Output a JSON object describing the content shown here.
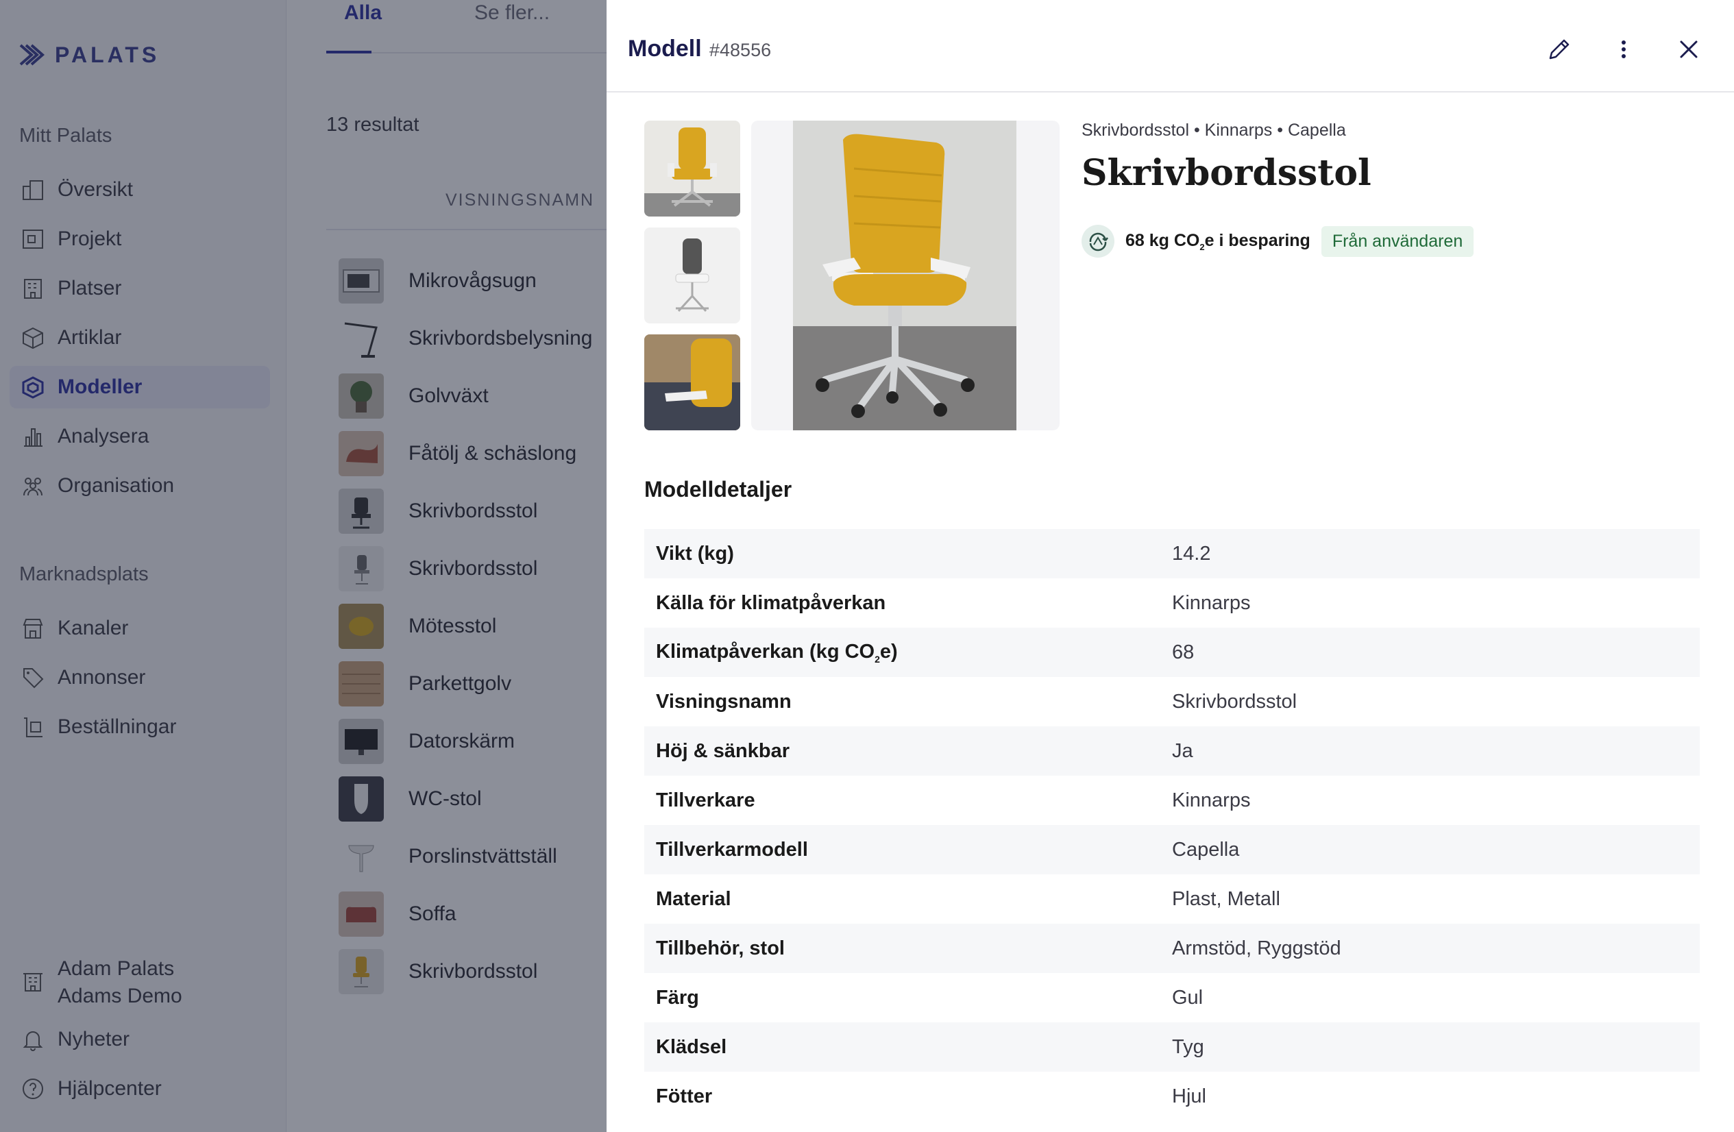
{
  "sidebar": {
    "brand": "PALATS",
    "section_mine": "Mitt Palats",
    "nav": [
      {
        "label": "Översikt",
        "icon": "overview-icon"
      },
      {
        "label": "Projekt",
        "icon": "project-icon"
      },
      {
        "label": "Platser",
        "icon": "building-icon"
      },
      {
        "label": "Artiklar",
        "icon": "box-icon"
      },
      {
        "label": "Modeller",
        "icon": "model-icon",
        "active": true
      },
      {
        "label": "Analysera",
        "icon": "bar-chart-icon"
      },
      {
        "label": "Organisation",
        "icon": "people-icon"
      }
    ],
    "section_market": "Marknadsplats",
    "market_nav": [
      {
        "label": "Kanaler",
        "icon": "store-icon"
      },
      {
        "label": "Annonser",
        "icon": "tag-icon"
      },
      {
        "label": "Beställningar",
        "icon": "orders-icon"
      }
    ],
    "user_name": "Adam Palats",
    "org_name": "Adams Demo",
    "news": "Nyheter",
    "help": "Hjälpcenter"
  },
  "main": {
    "tabs": [
      "Alla",
      "Se fler..."
    ],
    "results": "13 resultat",
    "column_header": "VISNINGSNAMN",
    "rows": [
      "Mikrovågsugn",
      "Skrivbordsbelysning",
      "Golvväxt",
      "Fåtölj & schäslong",
      "Skrivbordsstol",
      "Skrivbordsstol",
      "Mötesstol",
      "Parkettgolv",
      "Datorskärm",
      "WC-stol",
      "Porslinstvättställ",
      "Soffa",
      "Skrivbordsstol"
    ]
  },
  "panel": {
    "title": "Modell",
    "id": "#48556",
    "breadcrumb": "Skrivbordsstol • Kinnarps • Capella",
    "name": "Skrivbordsstol",
    "co2_prefix": "68 kg CO",
    "co2_sub": "2",
    "co2_suffix": "e i besparing",
    "source_badge": "Från användaren",
    "details_title": "Modelldetaljer",
    "details": [
      {
        "key": "Vikt (kg)",
        "value": "14.2"
      },
      {
        "key": "Källa för klimatpåverkan",
        "value": "Kinnarps"
      },
      {
        "key_prefix": "Klimatpåverkan (kg CO",
        "key_sub": "2",
        "key_suffix": "e)",
        "value": "68"
      },
      {
        "key": "Visningsnamn",
        "value": "Skrivbordsstol"
      },
      {
        "key": "Höj & sänkbar",
        "value": "Ja"
      },
      {
        "key": "Tillverkare",
        "value": "Kinnarps"
      },
      {
        "key": "Tillverkarmodell",
        "value": "Capella"
      },
      {
        "key": "Material",
        "value": "Plast, Metall"
      },
      {
        "key": "Tillbehör, stol",
        "value": "Armstöd, Ryggstöd"
      },
      {
        "key": "Färg",
        "value": "Gul"
      },
      {
        "key": "Klädsel",
        "value": "Tyg"
      },
      {
        "key": "Fötter",
        "value": "Hjul"
      }
    ]
  },
  "colors": {
    "accent": "#2f33a0",
    "chair_yellow": "#d9a520",
    "badge_green": "#1f6a38"
  }
}
